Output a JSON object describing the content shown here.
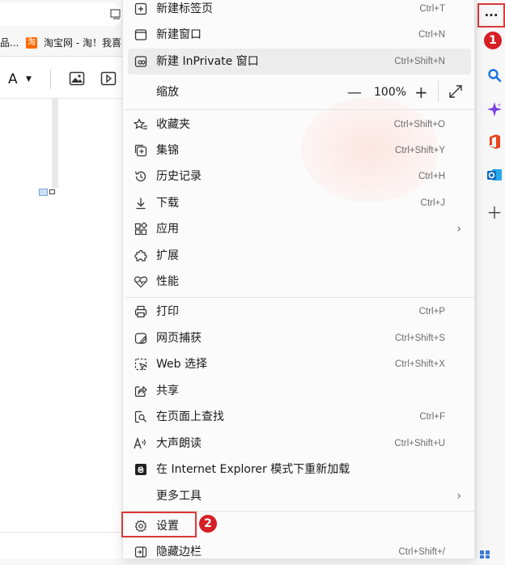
{
  "browser": {
    "favorites": [
      "品...",
      "淘宝网 - 淘！我喜"
    ],
    "taobao_icon_char": "淘",
    "doc_toolbar_font_letter": "A"
  },
  "sidebar": {
    "more_button_label": "···",
    "badge_1": "1",
    "icons": [
      "search-icon",
      "copilot-icon",
      "office-icon",
      "outlook-icon",
      "add-icon"
    ]
  },
  "menu": {
    "new_tab": {
      "label": "新建标签页",
      "shortcut": "Ctrl+T"
    },
    "new_window": {
      "label": "新建窗口",
      "shortcut": "Ctrl+N"
    },
    "new_inprivate": {
      "label": "新建 InPrivate 窗口",
      "shortcut": "Ctrl+Shift+N"
    },
    "zoom": {
      "label": "缩放",
      "minus": "—",
      "value": "100%",
      "plus": "+"
    },
    "favorites": {
      "label": "收藏夹",
      "shortcut": "Ctrl+Shift+O"
    },
    "collections": {
      "label": "集锦",
      "shortcut": "Ctrl+Shift+Y"
    },
    "history": {
      "label": "历史记录",
      "shortcut": "Ctrl+H"
    },
    "downloads": {
      "label": "下载",
      "shortcut": "Ctrl+J"
    },
    "apps": {
      "label": "应用",
      "chevron": "›"
    },
    "extensions": {
      "label": "扩展"
    },
    "performance": {
      "label": "性能"
    },
    "print": {
      "label": "打印",
      "shortcut": "Ctrl+P"
    },
    "web_capture": {
      "label": "网页捕获",
      "shortcut": "Ctrl+Shift+S"
    },
    "web_select": {
      "label": "Web 选择",
      "shortcut": "Ctrl+Shift+X"
    },
    "share": {
      "label": "共享"
    },
    "find": {
      "label": "在页面上查找",
      "shortcut": "Ctrl+F"
    },
    "read_aloud": {
      "label": "大声朗读",
      "shortcut": "Ctrl+Shift+U"
    },
    "ie_mode": {
      "label": "在 Internet Explorer 模式下重新加载"
    },
    "more_tools": {
      "label": "更多工具",
      "chevron": "›"
    },
    "settings": {
      "label": "设置"
    },
    "hide_sidebar": {
      "label": "隐藏边栏",
      "shortcut": "Ctrl+Shift+/"
    }
  },
  "annotations": {
    "badge_2": "2",
    "highlight_color": "#d93a3a"
  }
}
